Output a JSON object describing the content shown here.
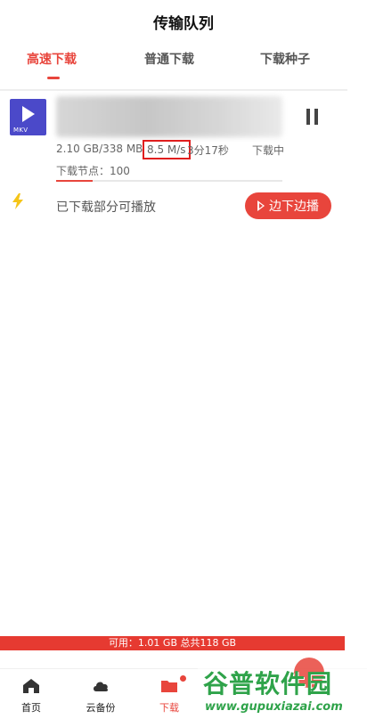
{
  "page": {
    "title": "传输队列"
  },
  "tabs": [
    {
      "label": "高速下载",
      "active": true
    },
    {
      "label": "普通下载",
      "active": false
    },
    {
      "label": "下载种子",
      "active": false
    }
  ],
  "task": {
    "file_type": "MKV",
    "size_progress": "2.10 GB/338 MB",
    "speed": "8.5 M/s",
    "time_remaining": "3分17秒",
    "status": "下载中",
    "nodes": "下载节点：100",
    "progress_fraction": 0.16
  },
  "playable": {
    "text": "已下载部分可播放",
    "button_label": "边下边播"
  },
  "storage": {
    "text": "可用：1.01 GB 总共118 GB"
  },
  "nav": [
    {
      "label": "首页",
      "icon": "home-icon"
    },
    {
      "label": "云备份",
      "icon": "cloud-icon"
    },
    {
      "label": "下载",
      "icon": "folder-icon",
      "active": true,
      "badge": true
    }
  ],
  "watermark": {
    "title": "谷普软件园",
    "url": "www.gupuxiazai.com"
  },
  "colors": {
    "accent": "#e8453c",
    "file_icon": "#4b49c9",
    "bolt": "#f5c518"
  }
}
